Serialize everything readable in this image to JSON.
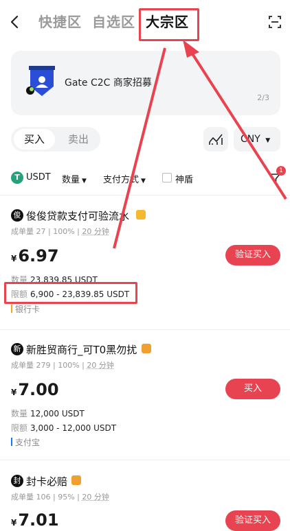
{
  "nav": {
    "back_icon": "chevron-left-icon",
    "tabs": [
      {
        "label": "快捷区",
        "active": false
      },
      {
        "label": "自选区",
        "active": false
      },
      {
        "label": "大宗区",
        "active": true
      }
    ],
    "scan_icon": "scan-icon"
  },
  "banner": {
    "title": "Gate C2C 商家招募",
    "pager": "2/3",
    "icon": "merchant-shield-icon"
  },
  "trade_side": {
    "buy": "买入",
    "sell": "卖出",
    "selected": "buy"
  },
  "chart_icon": "depth-chart-icon",
  "currency": {
    "value": "CNY"
  },
  "filters": {
    "coin": "USDT",
    "coin_icon_letter": "T",
    "amount": "数量",
    "payment": "支付方式",
    "shield_label": "神盾",
    "filter_badge": "1"
  },
  "ads": [
    {
      "avatar": "俊",
      "name": "俊俊贷款支付可验流水",
      "badge_color": "#f5b82e",
      "stats_orders_label": "成单量",
      "stats_orders": "27",
      "stats_rate": "100%",
      "stats_time": "20 分钟",
      "currency_symbol": "¥",
      "price": "6.97",
      "action": "验证买入",
      "quantity_label": "数量",
      "quantity": "23,839.85 USDT",
      "limit_label": "限额",
      "limit": "6,900 - 23,839.85 USDT",
      "payment": "银行卡",
      "payment_color": "#f5a623"
    },
    {
      "avatar": "新",
      "name": "新胜贸商行_可T0黑勿扰",
      "badge_color": "#f0a030",
      "stats_orders_label": "成单量",
      "stats_orders": "279",
      "stats_rate": "100%",
      "stats_time": "20 分钟",
      "currency_symbol": "¥",
      "price": "7.00",
      "action": "买入",
      "quantity_label": "数量",
      "quantity": "12,000 USDT",
      "limit_label": "限额",
      "limit": "3,000 - 12,000 USDT",
      "payment": "支付宝",
      "payment_color": "#1677ff"
    },
    {
      "avatar": "封",
      "name": "封卡必赔",
      "badge_color": "#f0a030",
      "stats_orders_label": "成单量",
      "stats_orders": "106",
      "stats_rate": "95%",
      "stats_time": "20 分钟",
      "currency_symbol": "¥",
      "price": "7.01",
      "action": "验证买入"
    }
  ],
  "colors": {
    "accent": "#e84350",
    "highlight": "#e8434e",
    "usdt": "#26a17b"
  }
}
